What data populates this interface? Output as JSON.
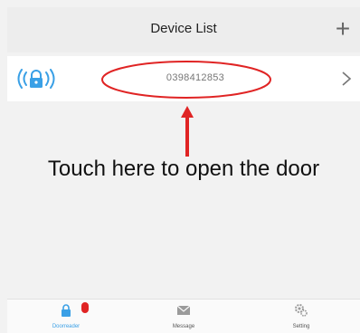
{
  "header": {
    "title": "Device List",
    "add_icon": "plus-icon",
    "add_label": "+"
  },
  "device": {
    "icon": "wireless-lock-icon",
    "number": "0398412853",
    "chevron_icon": "chevron-right-icon"
  },
  "annotation": {
    "text": "Touch here to open the door",
    "color": "#e02424"
  },
  "tabs": [
    {
      "label": "Doorreader",
      "icon": "lock-icon",
      "active": true,
      "badge": true
    },
    {
      "label": "Message",
      "icon": "envelope-icon",
      "active": false
    },
    {
      "label": "Setting",
      "icon": "gear-icon",
      "active": false
    }
  ],
  "colors": {
    "accent": "#3aa0e6",
    "badge": "#e02424",
    "header_bg": "#ededed",
    "page_bg": "#f2f2f2"
  }
}
